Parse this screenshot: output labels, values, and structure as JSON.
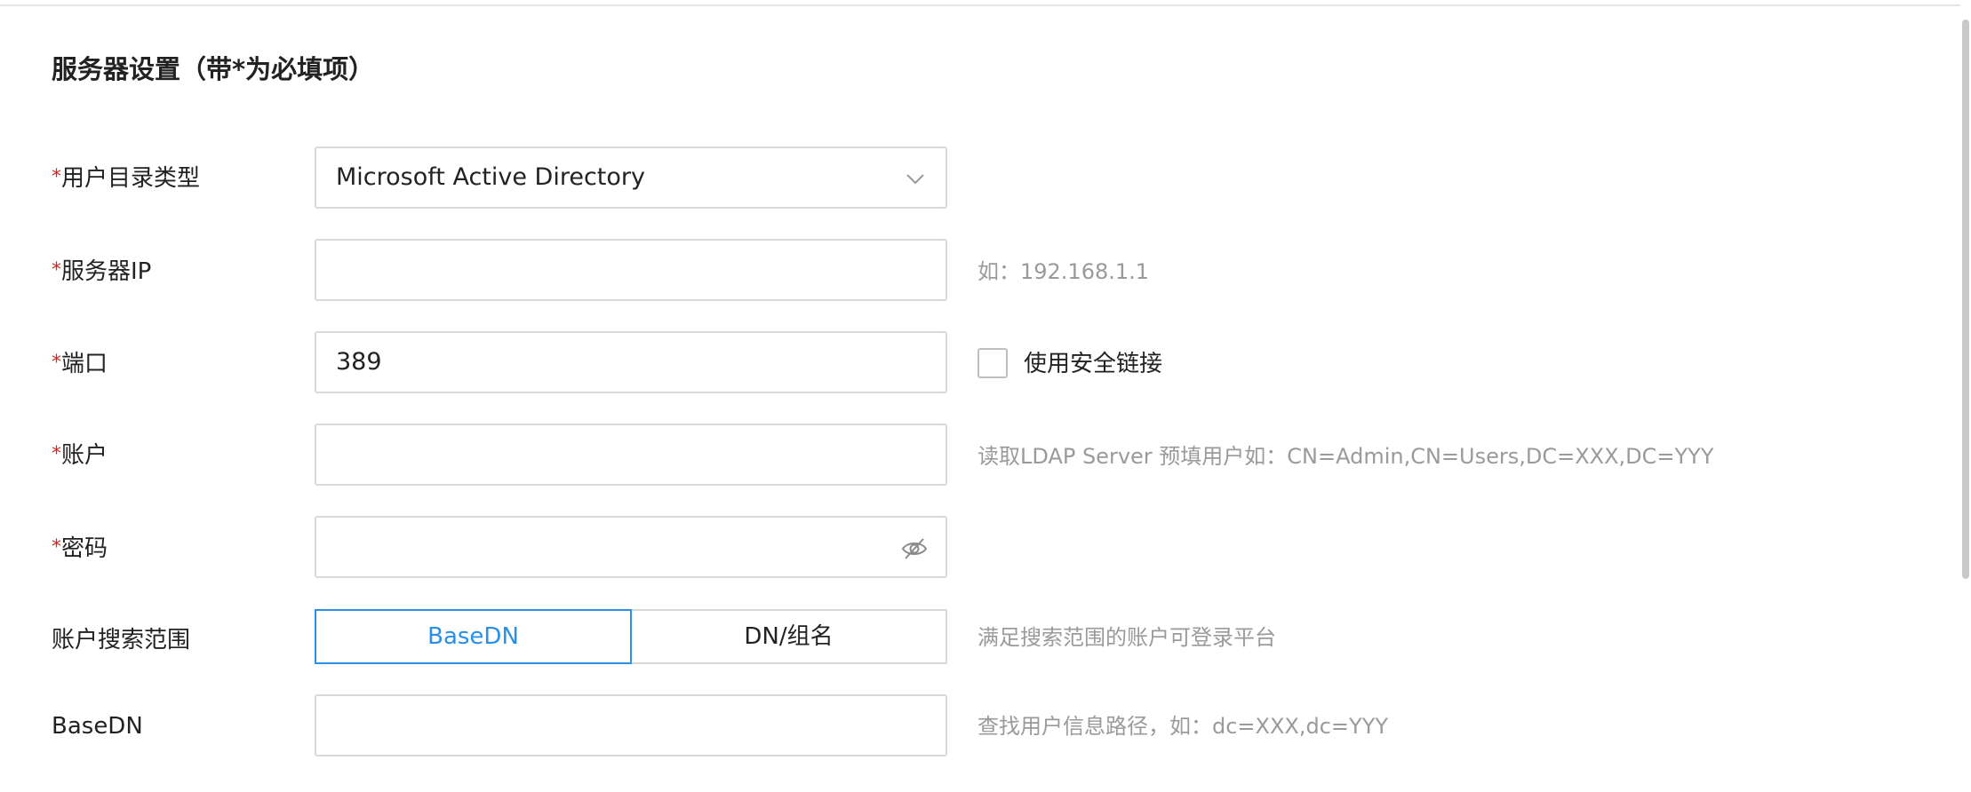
{
  "section": {
    "title": "服务器设置（带*为必填项）"
  },
  "form": {
    "required_mark": "*",
    "directory_type": {
      "label": "用户目录类型",
      "value": "Microsoft Active Directory",
      "icon": "chevron-down-icon"
    },
    "server_ip": {
      "label": "服务器IP",
      "value": "",
      "hint": "如：192.168.1.1"
    },
    "port": {
      "label": "端口",
      "value": "389",
      "secure_checkbox_label": "使用安全链接",
      "secure_checked": false
    },
    "account": {
      "label": "账户",
      "value": "",
      "hint": "读取LDAP Server 预填用户如：CN=Admin,CN=Users,DC=XXX,DC=YYY"
    },
    "password": {
      "label": "密码",
      "value": "",
      "icon": "eye-slash-icon"
    },
    "search_scope": {
      "label": "账户搜索范围",
      "options": [
        "BaseDN",
        "DN/组名"
      ],
      "selected": "BaseDN",
      "hint": "满足搜索范围的账户可登录平台"
    },
    "basedn": {
      "label": "BaseDN",
      "value": "",
      "hint": "查找用户信息路径，如：dc=XXX,dc=YYY"
    }
  },
  "colors": {
    "accent": "#2b8fe6",
    "required": "#e02020",
    "hint": "#9a9a9a",
    "border": "#d9d9d9"
  }
}
